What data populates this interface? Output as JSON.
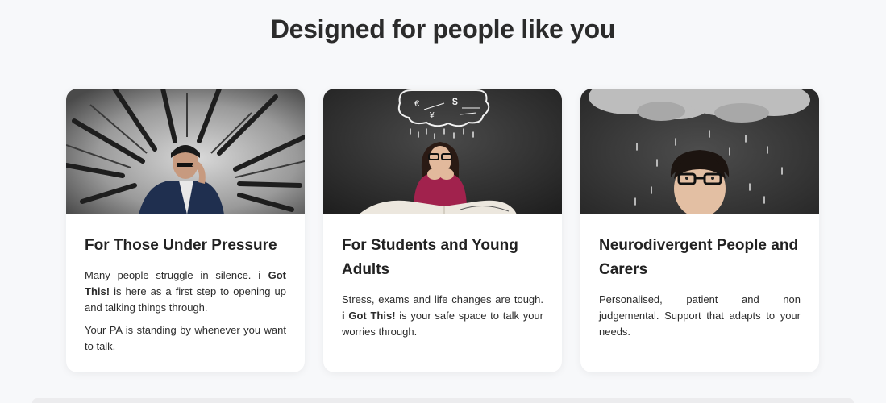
{
  "section": {
    "title": "Designed for people like you"
  },
  "cards": [
    {
      "title": "For Those Under Pressure",
      "image_icon": "stressed-man-image",
      "paragraphs": [
        {
          "before": "Many people struggle in silence. ",
          "bold": "i Got This!",
          "after": " is here as a first step to opening up and talking things through."
        },
        {
          "before": "Your PA is standing by whenever you want to talk.",
          "bold": "",
          "after": ""
        }
      ]
    },
    {
      "title": "For Students and Young Adults",
      "image_icon": "student-worry-image",
      "image_symbols": [
        "€",
        "$",
        "¥"
      ],
      "paragraphs": [
        {
          "before": "Stress, exams and life changes are tough. ",
          "bold": "i Got This!",
          "after": " is your safe space to talk your worries through."
        }
      ]
    },
    {
      "title": "Neurodivergent People and Carers",
      "image_icon": "rain-cloud-person-image",
      "paragraphs": [
        {
          "before": "Personalised, patient and non judgemental. Support that adapts to your needs.",
          "bold": "",
          "after": ""
        }
      ]
    }
  ],
  "colors": {
    "background": "#f7f8fa",
    "card": "#ffffff",
    "heading": "#2b2b2b"
  }
}
